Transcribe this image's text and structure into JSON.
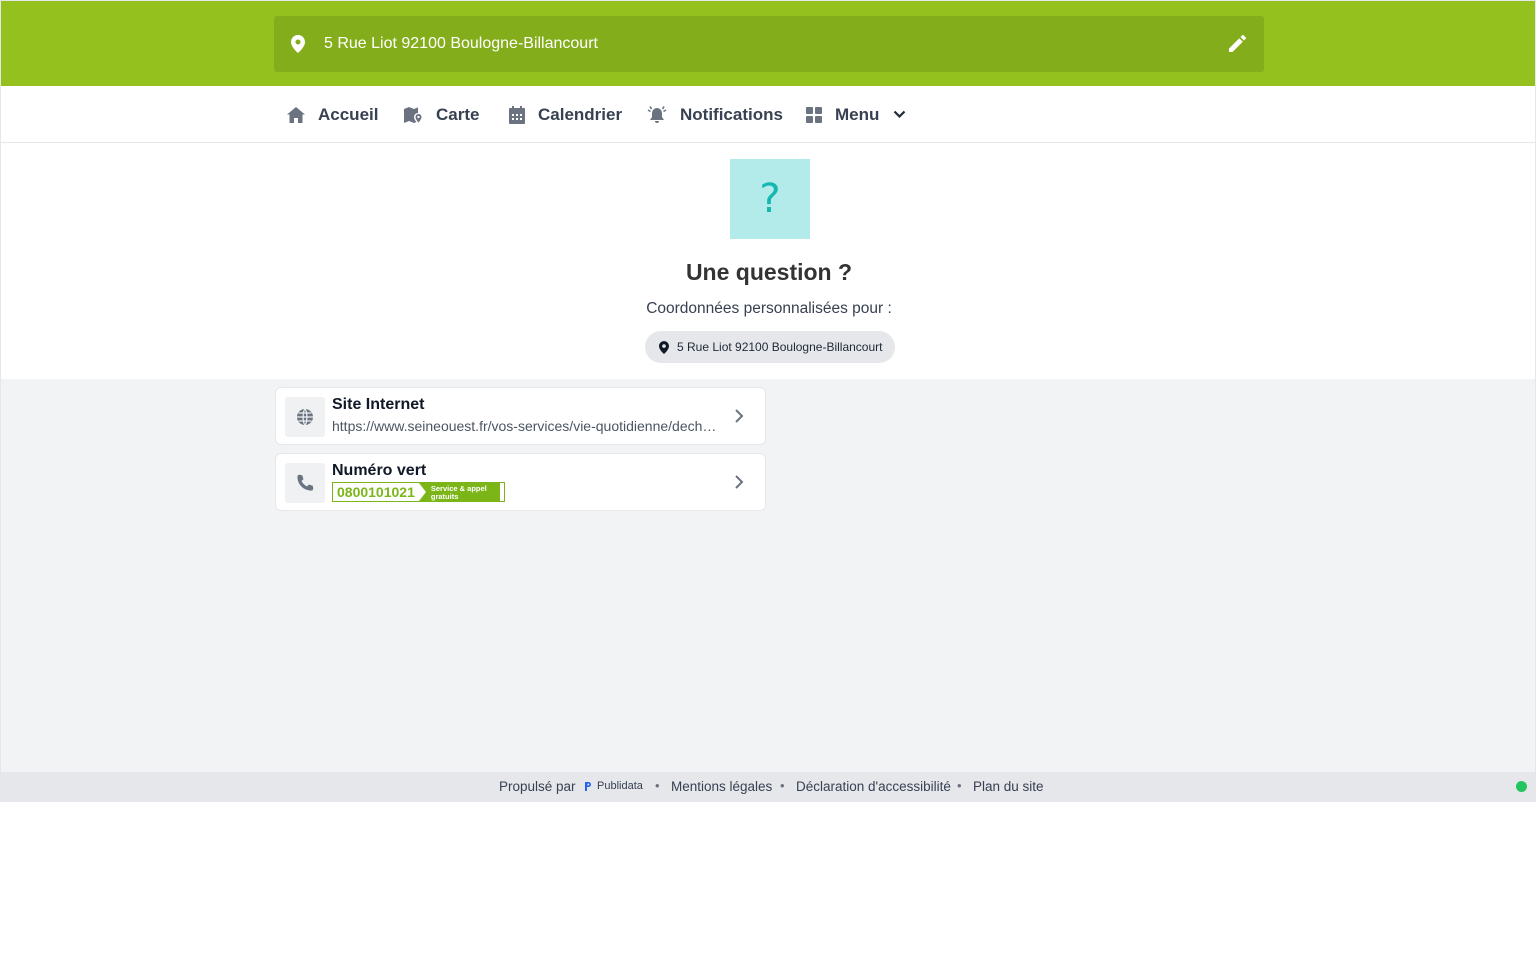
{
  "header": {
    "address": "5 Rue Liot 92100 Boulogne-Billancourt"
  },
  "nav": {
    "items": [
      {
        "label": "Accueil",
        "icon": "home-icon"
      },
      {
        "label": "Carte",
        "icon": "map-pin-icon"
      },
      {
        "label": "Calendrier",
        "icon": "calendar-icon"
      },
      {
        "label": "Notifications",
        "icon": "bell-alert-icon"
      },
      {
        "label": "Menu",
        "icon": "grid-icon"
      }
    ]
  },
  "hero": {
    "icon_glyph": "?",
    "title": "Une question ?",
    "subtitle": "Coordonnées personnalisées pour :",
    "address_chip": "5 Rue Liot 92100 Boulogne-Billancourt"
  },
  "cards": [
    {
      "title": "Site Internet",
      "value": "https://www.seineouest.fr/vos-services/vie-quotidienne/dechets-et-proprete",
      "icon": "globe-icon"
    },
    {
      "title": "Numéro vert",
      "number": "0800101021",
      "tag": "Service & appel gratuits",
      "icon": "phone-icon"
    }
  ],
  "footer": {
    "powered_by": "Propulsé par",
    "brand": "Publidata",
    "links": [
      "Mentions légales",
      "Déclaration d'accessibilité",
      "Plan du site"
    ],
    "separator": "•"
  },
  "colors": {
    "brand_green": "#95c11f",
    "address_box": "#84ad1b",
    "numvert_green": "#7cb518",
    "status_dot": "#22c55e"
  }
}
